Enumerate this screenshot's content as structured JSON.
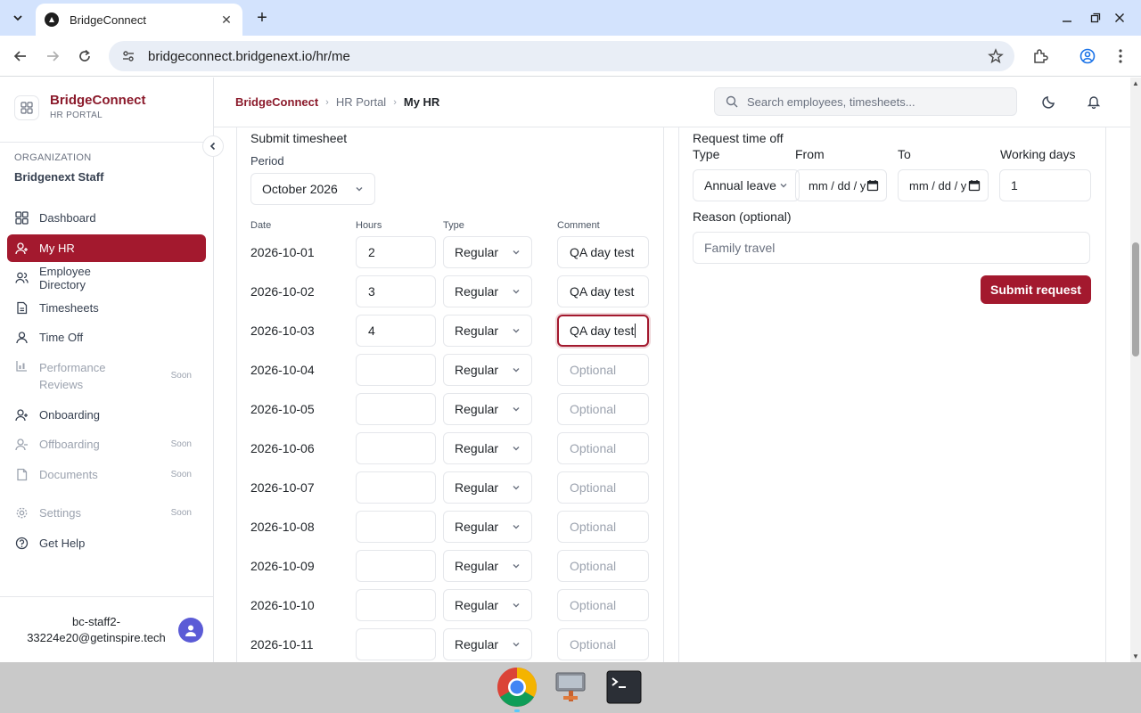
{
  "browser": {
    "tab_title": "BridgeConnect",
    "url": "bridgeconnect.bridgenext.io/hr/me"
  },
  "sidebar": {
    "brand_name": "BridgeConnect",
    "brand_sub": "HR PORTAL",
    "org_label": "ORGANIZATION",
    "org_name": "Bridgenext Staff",
    "items": [
      {
        "label": "Dashboard",
        "icon": "grid-icon",
        "active": false,
        "disabled": false
      },
      {
        "label": "My HR",
        "icon": "user-icon",
        "active": true,
        "disabled": false
      },
      {
        "label": "Employee Directory",
        "icon": "users-icon",
        "active": false,
        "disabled": false
      },
      {
        "label": "Timesheets",
        "icon": "document-icon",
        "active": false,
        "disabled": false
      },
      {
        "label": "Time Off",
        "icon": "person-icon",
        "active": false,
        "disabled": false
      },
      {
        "label": "Performance Reviews",
        "icon": "chart-icon",
        "active": false,
        "disabled": true,
        "badge": "Soon"
      },
      {
        "label": "Onboarding",
        "icon": "user-plus-icon",
        "active": false,
        "disabled": false
      },
      {
        "label": "Offboarding",
        "icon": "user-minus-icon",
        "active": false,
        "disabled": true,
        "badge": "Soon"
      },
      {
        "label": "Documents",
        "icon": "file-icon",
        "active": false,
        "disabled": true,
        "badge": "Soon"
      },
      {
        "label": "Settings",
        "icon": "gear-icon",
        "active": false,
        "disabled": true,
        "badge": "Soon"
      },
      {
        "label": "Get Help",
        "icon": "help-icon",
        "active": false,
        "disabled": false
      }
    ],
    "user_email": "bc-staff2-33224e20@getinspire.tech"
  },
  "topbar": {
    "crumb_home": "BridgeConnect",
    "crumb_mid": "HR Portal",
    "crumb_current": "My HR",
    "search_placeholder": "Search employees, timesheets..."
  },
  "timesheet": {
    "title": "Submit timesheet",
    "period_label": "Period",
    "period_value": "October 2026",
    "columns": {
      "date": "Date",
      "hours": "Hours",
      "type": "Type",
      "comment": "Comment"
    },
    "comment_placeholder": "Optional",
    "rows": [
      {
        "date": "2026-10-01",
        "hours": "2",
        "type": "Regular",
        "comment": "QA day test"
      },
      {
        "date": "2026-10-02",
        "hours": "3",
        "type": "Regular",
        "comment": "QA day test"
      },
      {
        "date": "2026-10-03",
        "hours": "4",
        "type": "Regular",
        "comment": "QA day test"
      },
      {
        "date": "2026-10-04",
        "hours": "",
        "type": "Regular",
        "comment": ""
      },
      {
        "date": "2026-10-05",
        "hours": "",
        "type": "Regular",
        "comment": ""
      },
      {
        "date": "2026-10-06",
        "hours": "",
        "type": "Regular",
        "comment": ""
      },
      {
        "date": "2026-10-07",
        "hours": "",
        "type": "Regular",
        "comment": ""
      },
      {
        "date": "2026-10-08",
        "hours": "",
        "type": "Regular",
        "comment": ""
      },
      {
        "date": "2026-10-09",
        "hours": "",
        "type": "Regular",
        "comment": ""
      },
      {
        "date": "2026-10-10",
        "hours": "",
        "type": "Regular",
        "comment": ""
      },
      {
        "date": "2026-10-11",
        "hours": "",
        "type": "Regular",
        "comment": ""
      }
    ]
  },
  "time_off": {
    "title": "Request time off",
    "type_label": "Type",
    "type_value": "Annual leave",
    "from_label": "From",
    "from_value": "mm / dd / yyyy",
    "to_label": "To",
    "to_value": "mm / dd / yyyy",
    "days_label": "Working days",
    "days_value": "1",
    "reason_label": "Reason (optional)",
    "reason_value": "Family travel",
    "submit_label": "Submit request"
  },
  "colors": {
    "brand": "#a3192e",
    "brand_text": "#8b1a2b"
  }
}
